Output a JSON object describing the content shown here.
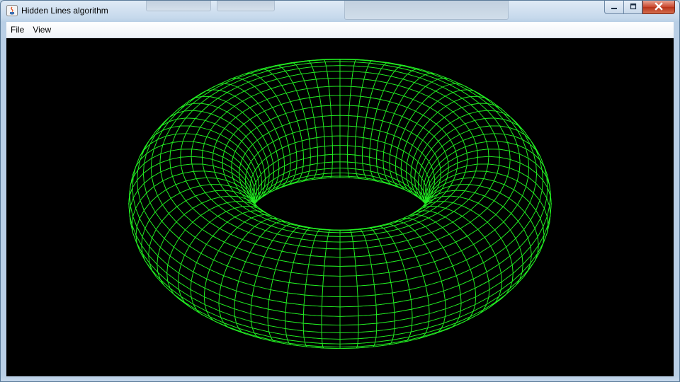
{
  "window": {
    "title": "Hidden Lines algorithm",
    "app_icon": "java-icon"
  },
  "caption_buttons": {
    "minimize_icon": "minimize-icon",
    "maximize_icon": "maximize-icon",
    "close_icon": "close-icon"
  },
  "menubar": {
    "items": [
      {
        "label": "File"
      },
      {
        "label": "View"
      }
    ]
  },
  "scene": {
    "object": "torus wireframe",
    "background_color": "#000000",
    "wire_color": "#22ee22",
    "hidden_lines_removed": true
  },
  "colors": {
    "title_bar": "#c6d9ec",
    "close_button": "#c9462c",
    "menu_bar": "#f4f7fb"
  }
}
